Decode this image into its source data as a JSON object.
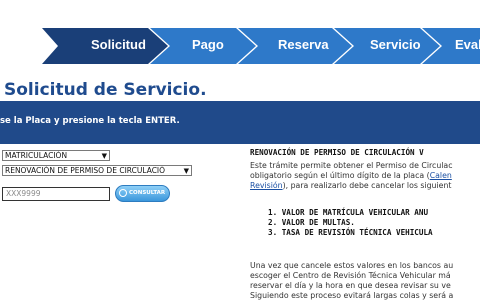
{
  "steps": [
    {
      "label": "Solicitud",
      "active": true
    },
    {
      "label": "Pago",
      "active": false
    },
    {
      "label": "Reserva",
      "active": false
    },
    {
      "label": "Servicio",
      "active": false
    },
    {
      "label": "Eval",
      "active": false
    }
  ],
  "colors": {
    "step_active": "#1a3f78",
    "step_inactive": "#2e79c9",
    "banner": "#204a8a",
    "title": "#1f4b8e",
    "link": "#1a4fa3"
  },
  "page_title": "Solicitud de Servicio.",
  "banner_text": "se la Placa y presione la tecla ENTER.",
  "form": {
    "process_select": "MATRICULACIÓN",
    "procedure_select": "RENOVACIÓN DE PERMISO DE CIRCULACIÓ",
    "plate_placeholder": "XXX9999",
    "consult_button": "CONSULTAR"
  },
  "info": {
    "heading": "RENOVACIÓN DE PERMISO DE CIRCULACIÓN V",
    "line1": "Este trámite permite obtener el Permiso de Circulac",
    "line2_pre": "obligatorio según el último dígito de la placa (",
    "line2_link": "Calen",
    "line3_link": "Revisión",
    "line3_post": "), para realizarlo debe cancelar los siguient",
    "items": [
      "1. VALOR DE MATRÍCULA VEHICULAR ANU",
      "2. VALOR DE MULTAS.",
      "3. TASA DE REVISIÓN TÉCNICA VEHICULA"
    ],
    "para2": [
      "Una vez que cancele estos valores en los bancos au",
      "escoger el Centro de Revisión Técnica Vehicular má",
      "reservar el día y la hora en que desea revisar su ve",
      "Siguiendo este proceso evitará largas colas y será a"
    ]
  }
}
